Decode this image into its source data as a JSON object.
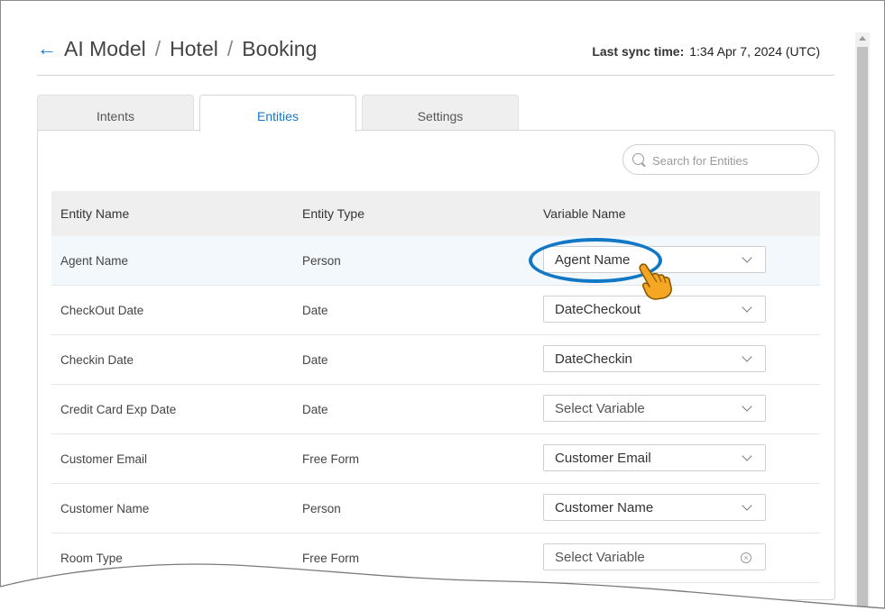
{
  "header": {
    "breadcrumb": [
      "AI Model",
      "Hotel",
      "Booking"
    ],
    "sync_label": "Last sync time:",
    "sync_value": "1:34 Apr 7, 2024 (UTC)"
  },
  "tabs": [
    {
      "label": "Intents",
      "active": false
    },
    {
      "label": "Entities",
      "active": true
    },
    {
      "label": "Settings",
      "active": false
    }
  ],
  "search": {
    "placeholder": "Search for Entities",
    "value": ""
  },
  "table": {
    "columns": [
      "Entity Name",
      "Entity Type",
      "Variable Name"
    ],
    "rows": [
      {
        "entity": "Agent Name",
        "type": "Person",
        "variable": "Agent Name",
        "placeholder": false
      },
      {
        "entity": "CheckOut Date",
        "type": "Date",
        "variable": "DateCheckout",
        "placeholder": false
      },
      {
        "entity": "Checkin Date",
        "type": "Date",
        "variable": "DateCheckin",
        "placeholder": false
      },
      {
        "entity": "Credit Card Exp Date",
        "type": "Date",
        "variable": "Select Variable",
        "placeholder": true
      },
      {
        "entity": "Customer Email",
        "type": "Free Form",
        "variable": "Customer Email",
        "placeholder": false
      },
      {
        "entity": "Customer Name",
        "type": "Person",
        "variable": "Customer Name",
        "placeholder": false
      },
      {
        "entity": "Room Type",
        "type": "Free Form",
        "variable": "Select Variable",
        "placeholder": true
      }
    ]
  },
  "icons": {
    "back": "arrow-left-icon",
    "search": "search-icon",
    "dropdown": "chevron-down-icon",
    "clear": "clear-icon",
    "pointer": "hand-pointer-icon"
  },
  "colors": {
    "accent": "#1677c9",
    "highlight_ring": "#1277c4",
    "hand": "#f5a623"
  }
}
